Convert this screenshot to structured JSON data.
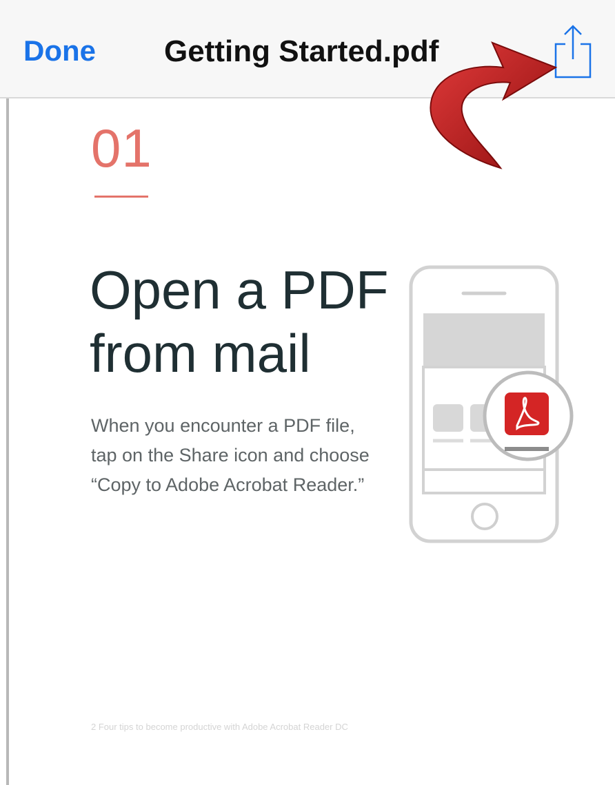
{
  "toolbar": {
    "done_label": "Done",
    "title": "Getting Started.pdf",
    "share_icon": "share-icon"
  },
  "page": {
    "step_number": "01",
    "headline_line1": "Open a PDF",
    "headline_line2": "from mail",
    "body_line1": "When you encounter a PDF file,",
    "body_line2": "tap on the Share icon and choose",
    "body_line3": "“Copy to Adobe Acrobat Reader.”",
    "footer": "2  Four tips to become productive with Adobe Acrobat Reader DC"
  },
  "illustration": {
    "device": "phone-illustration",
    "app_icon": "acrobat-icon"
  },
  "colors": {
    "accent_blue": "#1a73e8",
    "step_red": "#e4736a",
    "acrobat_red": "#d42525",
    "arrow_red": "#c81e1e"
  }
}
